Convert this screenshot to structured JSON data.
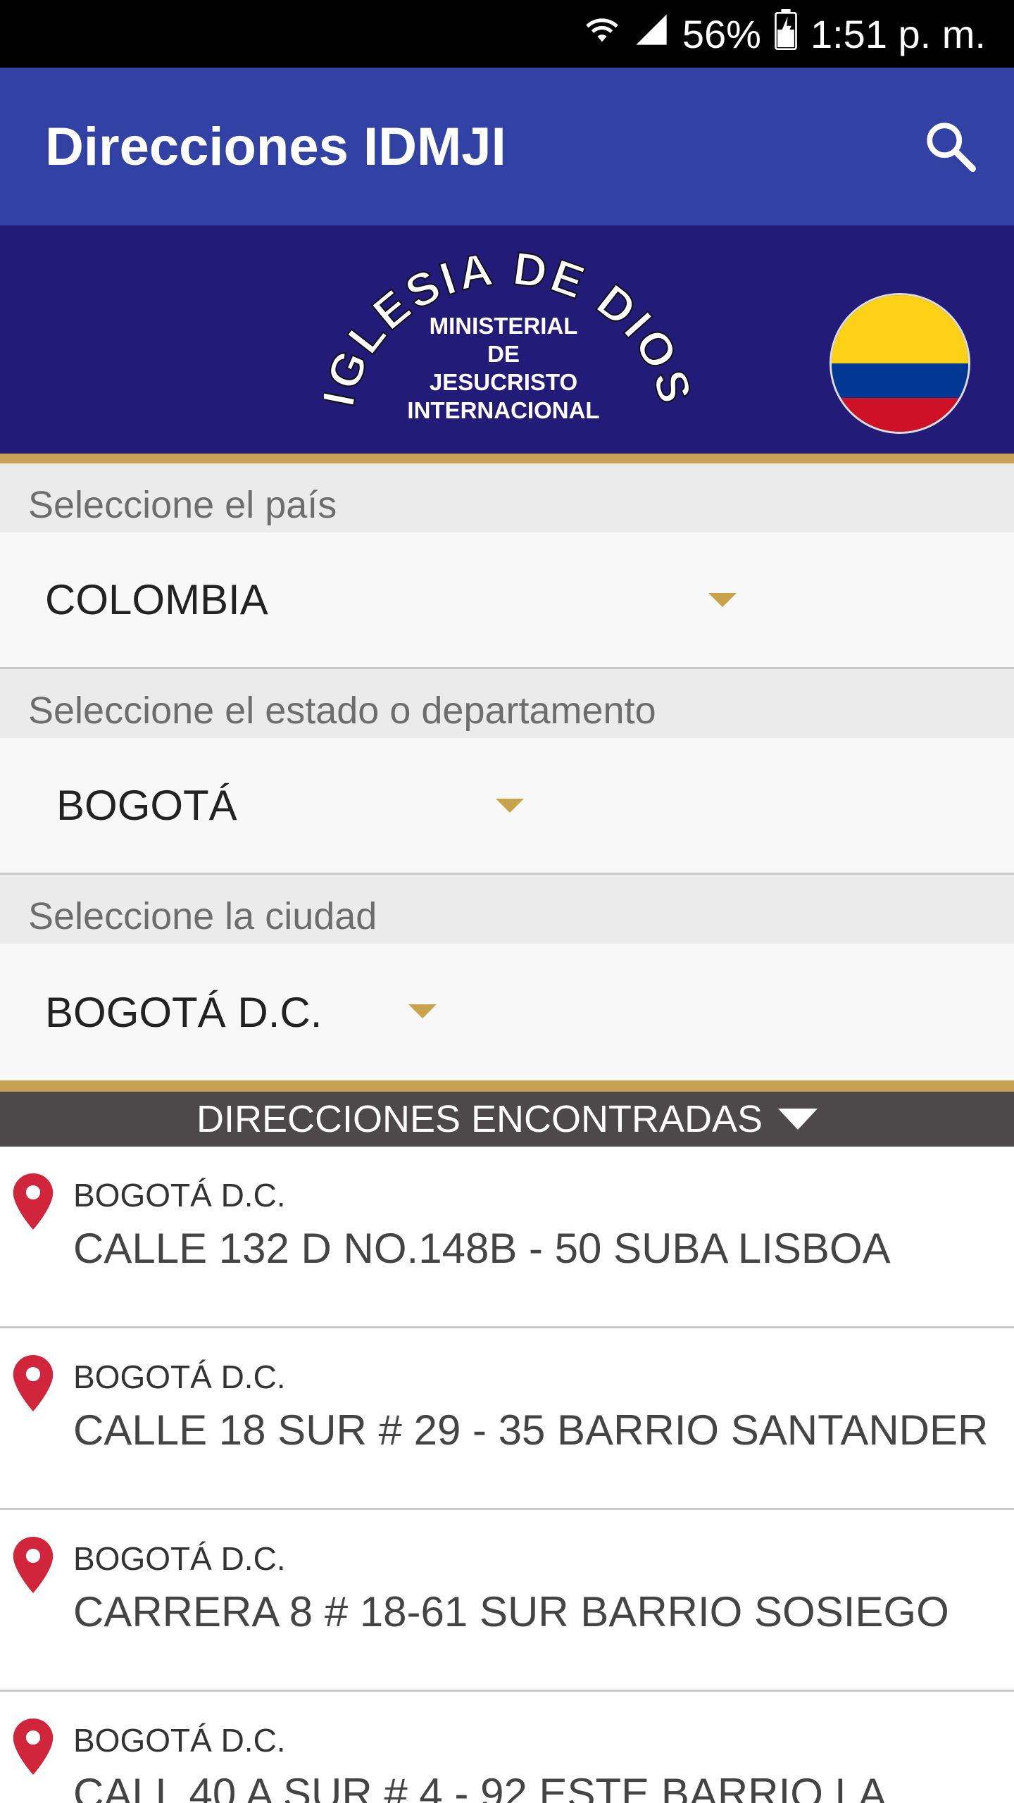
{
  "status_bar": {
    "battery": "56%",
    "time": "1:51 p. m."
  },
  "app_bar": {
    "title": "Direcciones IDMJI"
  },
  "banner": {
    "logo_arc_text": "IGLESIA DE DIOS",
    "logo_lines": [
      "MINISTERIAL",
      "DE",
      "JESUCRISTO",
      "INTERNACIONAL"
    ],
    "flag_colors": [
      "#fcd116",
      "#003893",
      "#ce1126"
    ]
  },
  "country": {
    "label": "Seleccione el país",
    "value": "COLOMBIA"
  },
  "state": {
    "label": "Seleccione el estado o departamento",
    "value": "BOGOTÁ"
  },
  "city": {
    "label": "Seleccione la ciudad",
    "value": "BOGOTÁ D.C."
  },
  "results": {
    "header": "DIRECCIONES ENCONTRADAS",
    "items": [
      {
        "city": "BOGOTÁ D.C.",
        "address": "CALLE 132 D NO.148B - 50 SUBA LISBOA"
      },
      {
        "city": "BOGOTÁ D.C.",
        "address": "CALLE 18 SUR # 29 - 35 BARRIO SANTANDER"
      },
      {
        "city": "BOGOTÁ D.C.",
        "address": "CARRERA 8  # 18-61 SUR  BARRIO SOSIEGO"
      },
      {
        "city": "BOGOTÁ D.C.",
        "address": "CALL 40 A SUR # 4 - 92 ESTE   BARRIO LA"
      }
    ]
  },
  "colors": {
    "app_bar": "#3242a4",
    "banner": "#221c78",
    "gold": "#c8a154",
    "pin": "#d0253a",
    "results_header": "#4d4849"
  }
}
